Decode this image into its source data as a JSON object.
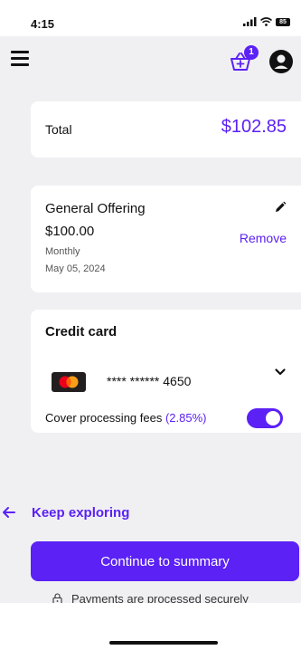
{
  "status": {
    "time": "4:15",
    "battery": "85"
  },
  "header": {
    "cart_count": "1"
  },
  "total": {
    "label": "Total",
    "value": "$102.85"
  },
  "offering": {
    "title": "General Offering",
    "amount": "$100.00",
    "frequency": "Monthly",
    "date": "May 05, 2024",
    "remove_label": "Remove"
  },
  "payment": {
    "title": "Credit card",
    "card_number": "**** ****** 4650",
    "fees_label": "Cover processing fees",
    "fees_percent": "(2.85%)",
    "cover_fees_enabled": true
  },
  "actions": {
    "explore_label": "Keep exploring",
    "continue_label": "Continue to summary",
    "secure_note": "Payments are processed securely"
  },
  "colors": {
    "accent": "#5b21f5",
    "background": "#f0f0f3"
  },
  "icons": [
    "menu-icon",
    "cart-icon",
    "account-icon",
    "pencil-icon",
    "chevron-down-icon",
    "mastercard-icon",
    "arrow-left-icon",
    "lock-icon"
  ]
}
